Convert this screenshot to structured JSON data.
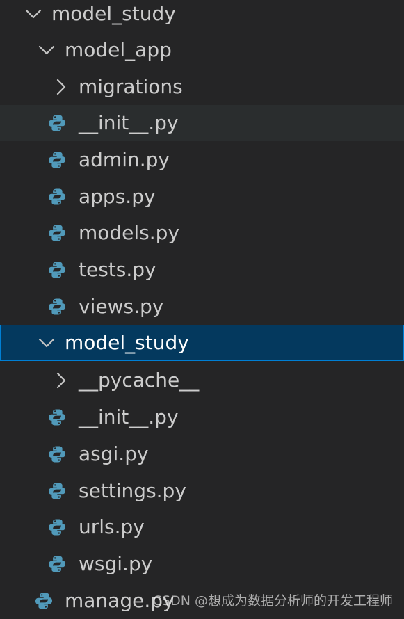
{
  "tree": {
    "root_folder": "model_study",
    "app_folder": {
      "name": "model_app",
      "migrations": "migrations",
      "files": [
        "__init__.py",
        "admin.py",
        "apps.py",
        "models.py",
        "tests.py",
        "views.py"
      ]
    },
    "project_folder": {
      "name": "model_study",
      "pycache": "__pycache__",
      "files": [
        "__init__.py",
        "asgi.py",
        "settings.py",
        "urls.py",
        "wsgi.py"
      ]
    },
    "manage_file": "manage.py"
  },
  "watermark": "CSDN @想成为数据分析师的开发工程师",
  "colors": {
    "background": "#252526",
    "selected_bg": "#04395e",
    "selected_border": "#007fd4",
    "hover_bg": "#2a2d2e",
    "text": "#cccccc",
    "python_blue": "#519aba"
  },
  "icons": {
    "folder_expanded": "chevron-down-icon",
    "folder_collapsed": "chevron-right-icon",
    "python_file": "python-file-icon"
  }
}
